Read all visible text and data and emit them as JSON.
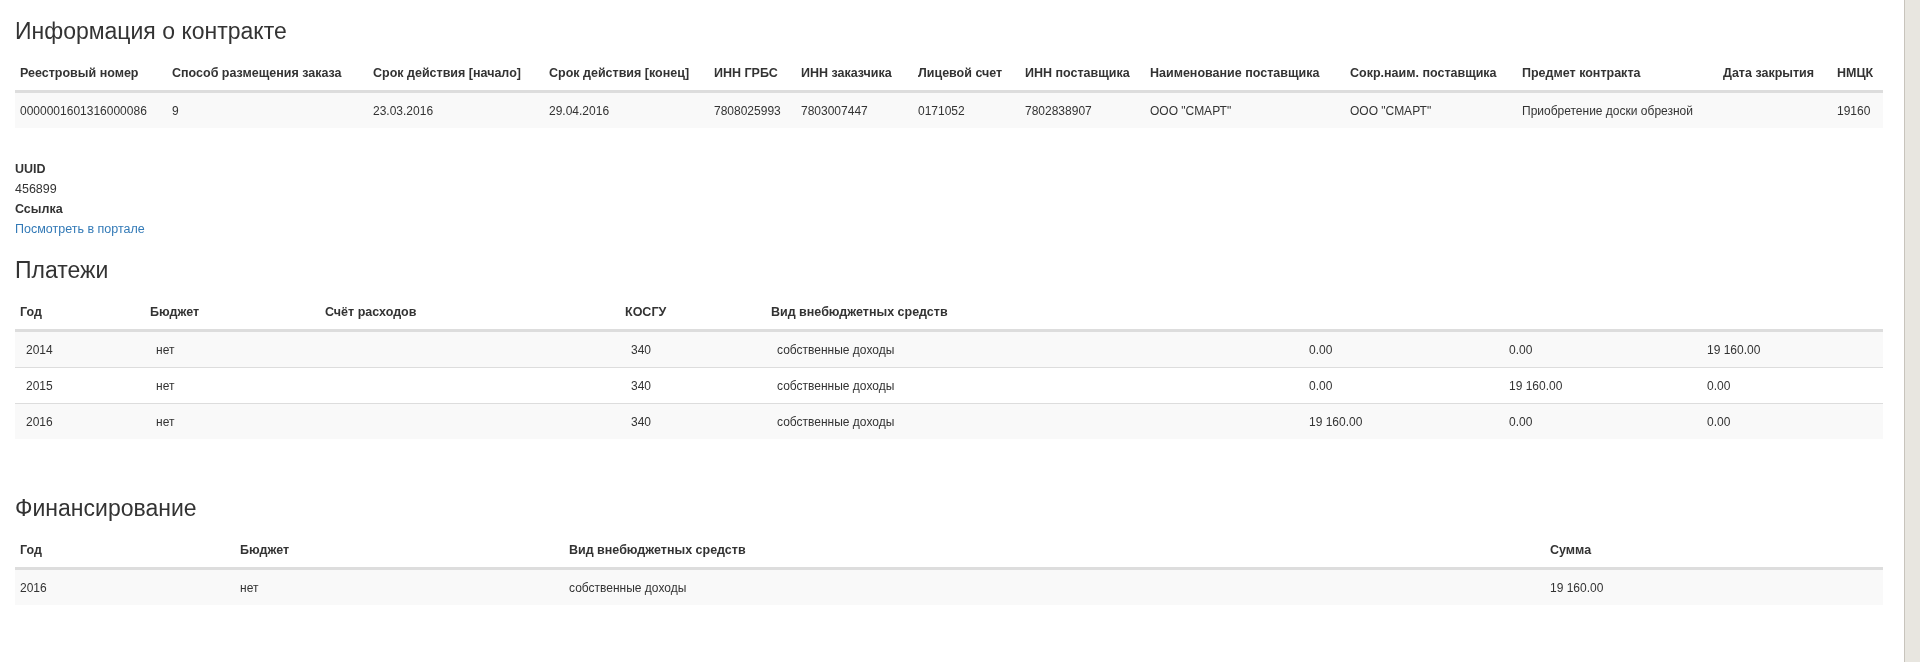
{
  "contract": {
    "title": "Информация о контракте",
    "columns": [
      "Реестровый номер",
      "Способ размещения заказа",
      "Срок действия [начало]",
      "Срок действия [конец]",
      "ИНН ГРБС",
      "ИНН заказчика",
      "Лицевой счет",
      "ИНН поставщика",
      "Наименование поставщика",
      "Сокр.наим. поставщика",
      "Предмет контракта",
      "Дата закрытия",
      "НМЦК"
    ],
    "rows": [
      [
        "0000001601316000086",
        "9",
        "23.03.2016",
        "29.04.2016",
        "7808025993",
        "7803007447",
        "0171052",
        "7802838907",
        "ООО \"СМАРТ\"",
        "ООО \"СМАРТ\"",
        "Приобретение доски обрезной",
        "",
        "19160"
      ]
    ]
  },
  "details": [
    {
      "label": "UUID",
      "value": "456899",
      "kind": "text"
    },
    {
      "label": "Ссылка",
      "value": "Посмотреть в портале",
      "kind": "link"
    }
  ],
  "payments": {
    "title": "Платежи",
    "columns": [
      "Год",
      "Бюджет",
      "Счёт расходов",
      "КОСГУ",
      "Вид внебюджетных средств"
    ],
    "rows": [
      [
        "2014",
        "нет",
        "",
        "340",
        "собственные доходы",
        "0.00",
        "0.00",
        "19 160.00"
      ],
      [
        "2015",
        "нет",
        "",
        "340",
        "собственные доходы",
        "0.00",
        "19 160.00",
        "0.00"
      ],
      [
        "2016",
        "нет",
        "",
        "340",
        "собственные доходы",
        "19 160.00",
        "0.00",
        "0.00"
      ]
    ]
  },
  "financing": {
    "title": "Финансирование",
    "columns": [
      "Год",
      "Бюджет",
      "Вид внебюджетных средств",
      "Сумма"
    ],
    "rows": [
      [
        "2016",
        "нет",
        "собственные доходы",
        "19 160.00"
      ]
    ]
  }
}
